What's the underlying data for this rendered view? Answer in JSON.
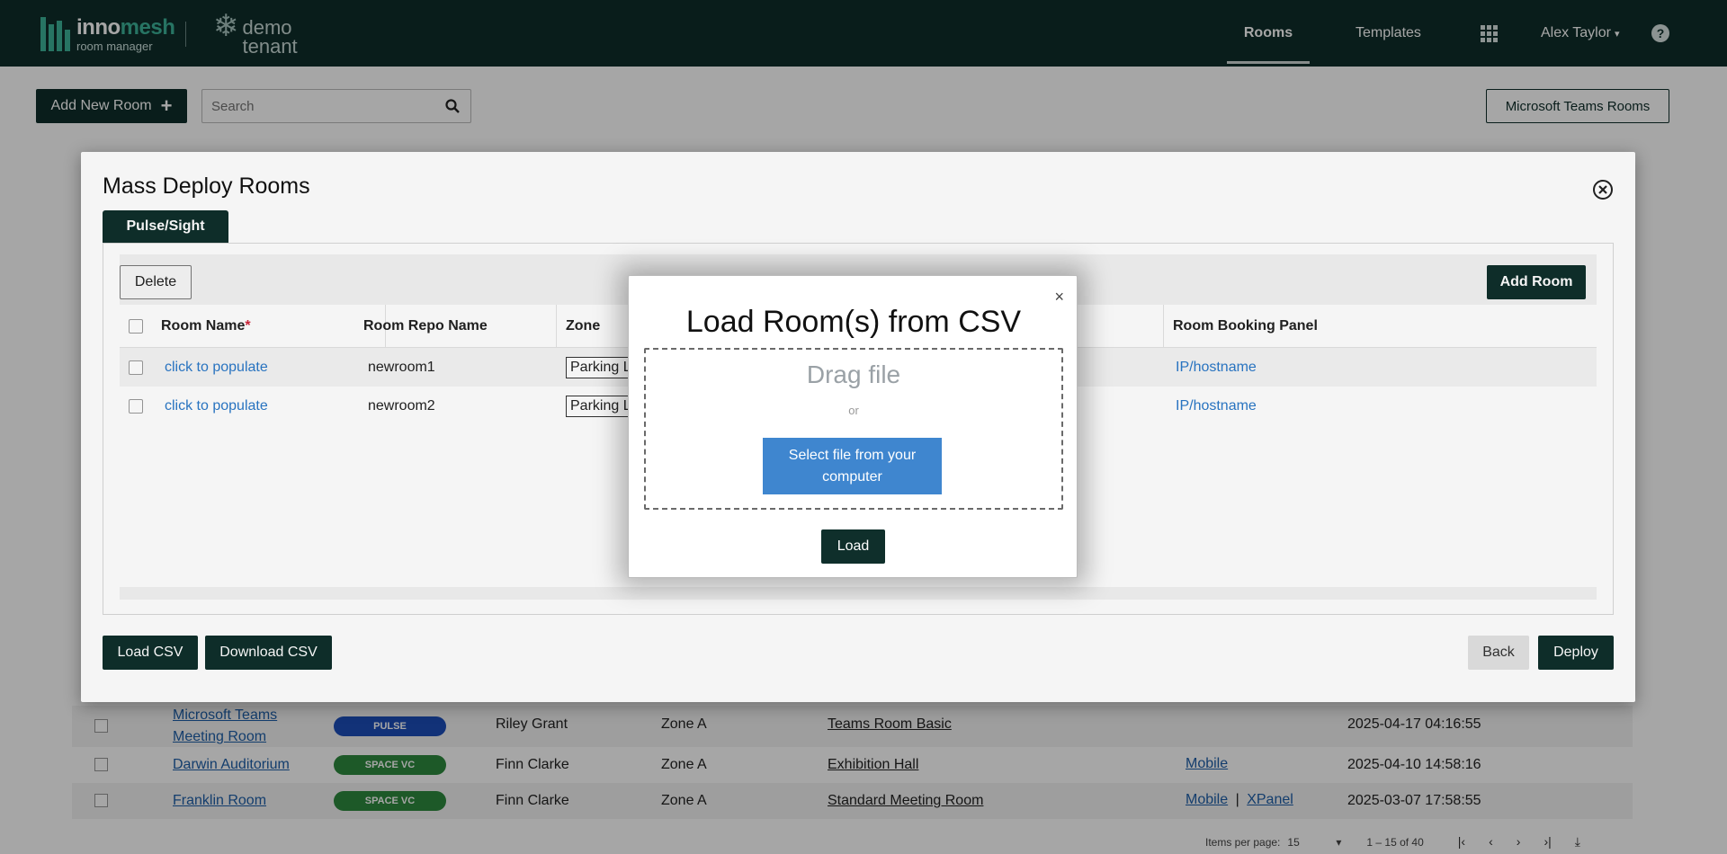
{
  "brand": {
    "name_a": "inno",
    "name_b": "mesh",
    "sub": "room manager",
    "tenant_line1": "demo",
    "tenant_line2": "tenant"
  },
  "nav": {
    "rooms": "Rooms",
    "templates": "Templates",
    "user": "Alex Taylor",
    "user_caret": "▾",
    "help": "?"
  },
  "toolbar": {
    "add_room": "Add New Room",
    "add_icon": "+",
    "search_placeholder": "Search",
    "teams_rooms": "Microsoft Teams Rooms"
  },
  "bg_rows": [
    {
      "name": "Microsoft Teams Meeting Room",
      "badge": "PULSE",
      "owner": "Riley Grant",
      "zone": "Zone A",
      "template": "Teams Room Basic",
      "panel_a": "",
      "panel_sep": "",
      "panel_b": "",
      "date": "2025-04-17 04:16:55"
    },
    {
      "name": "Darwin Auditorium",
      "badge": "SPACE VC",
      "owner": "Finn Clarke",
      "zone": "Zone A",
      "template": "Exhibition Hall",
      "panel_a": "Mobile",
      "panel_sep": "",
      "panel_b": "",
      "date": "2025-04-10 14:58:16"
    },
    {
      "name": "Franklin Room",
      "badge": "SPACE VC",
      "owner": "Finn Clarke",
      "zone": "Zone A",
      "template": "Standard Meeting Room",
      "panel_a": "Mobile",
      "panel_sep": "|",
      "panel_b": "XPanel",
      "date": "2025-03-07 17:58:55"
    }
  ],
  "pager": {
    "items_label": "Items per page:",
    "items_value": "15",
    "caret": "▾",
    "range": "1 – 15 of 40"
  },
  "modal": {
    "title": "Mass Deploy Rooms",
    "tab": "Pulse/Sight",
    "delete": "Delete",
    "add_room": "Add Room",
    "headers": {
      "room_name": "Room Name",
      "required": "*",
      "repo": "Room Repo Name",
      "zone": "Zone Nam",
      "booking": "Room Booking Panel"
    },
    "rows": [
      {
        "name": "click to populate",
        "repo": "newroom1",
        "zone": "Parking L",
        "booking": "IP/hostname"
      },
      {
        "name": "click to populate",
        "repo": "newroom2",
        "zone": "Parking L",
        "booking": "IP/hostname"
      }
    ],
    "load_csv": "Load CSV",
    "download_csv": "Download CSV",
    "back": "Back",
    "deploy": "Deploy"
  },
  "csv_dialog": {
    "close": "×",
    "title": "Load Room(s) from CSV",
    "drag": "Drag file",
    "or": "or",
    "select": "Select file from your computer",
    "load": "Load"
  },
  "colors": {
    "nav_bg": "#0f2f2b",
    "accent": "#3db39a",
    "link": "#2a78c8",
    "pulse_badge": "#1d4fb8",
    "space_badge": "#2e8a3e",
    "select_btn": "#3f86cf"
  }
}
